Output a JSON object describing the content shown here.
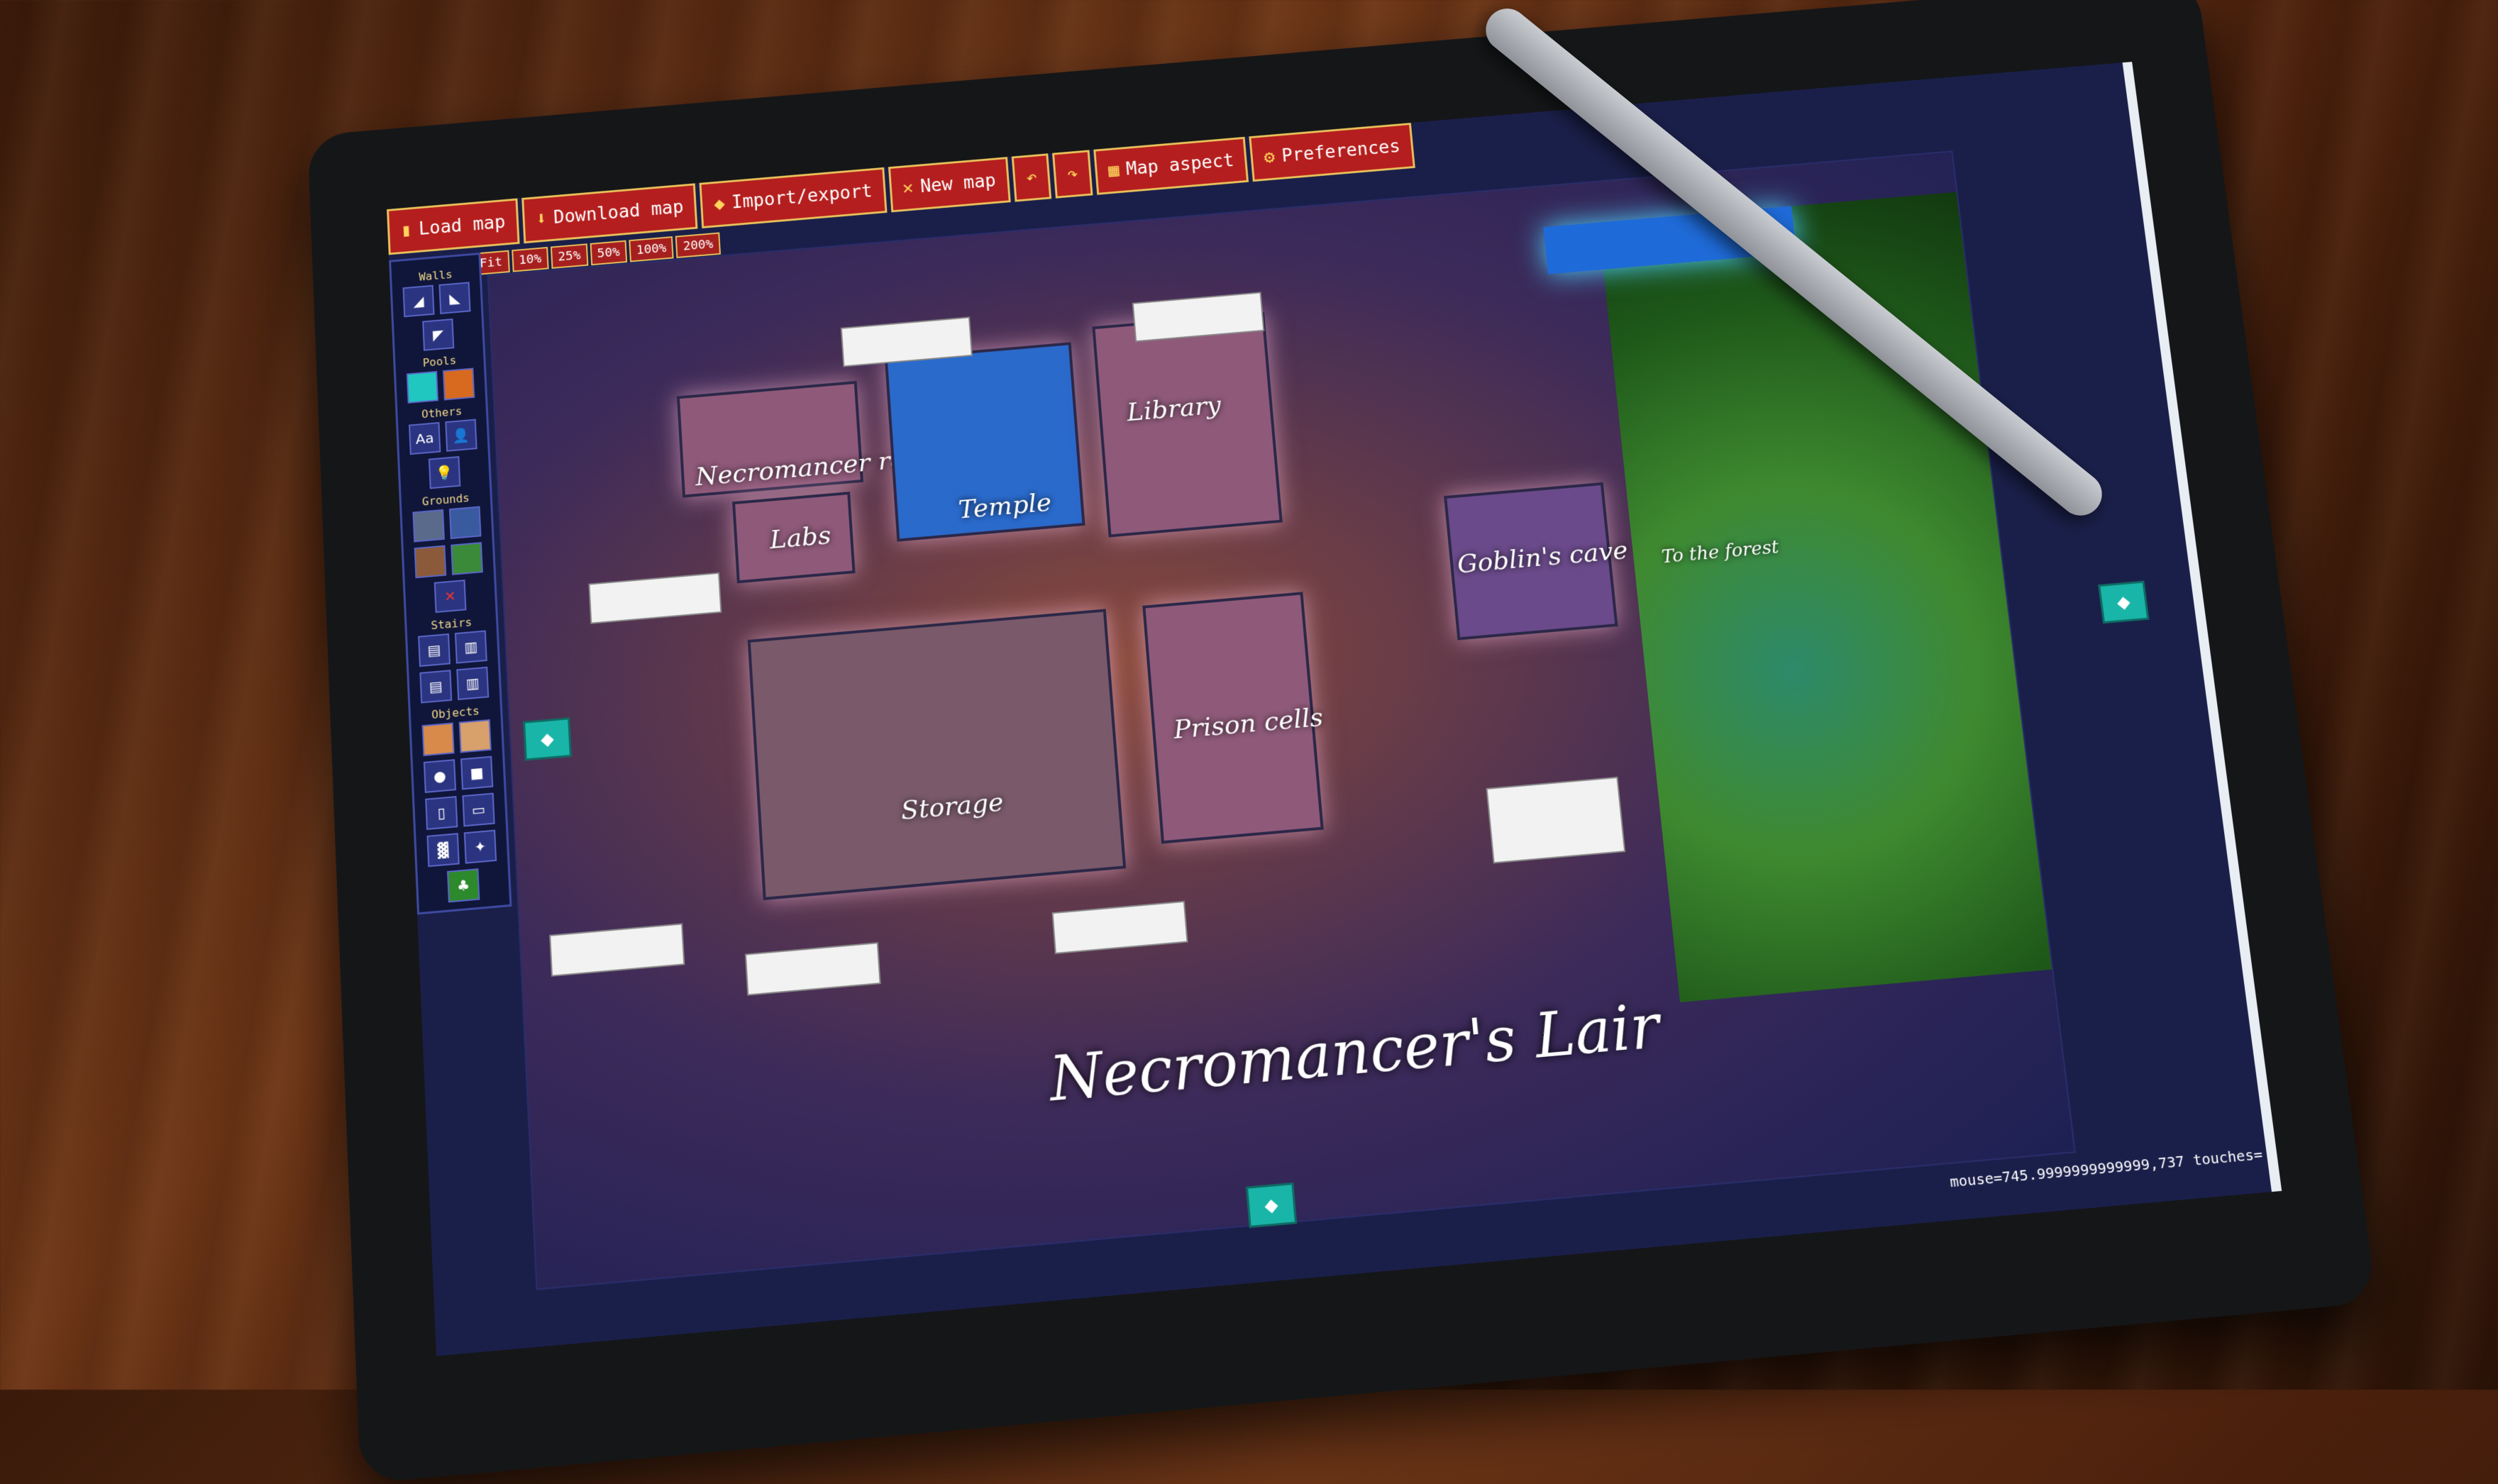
{
  "toolbar": {
    "load_map": "Load map",
    "download_map": "Download map",
    "import_export": "Import/export",
    "new_map": "New map",
    "map_aspect": "Map aspect",
    "preferences": "Preferences"
  },
  "zoom": {
    "fit": "Fit",
    "z10": "10%",
    "z25": "25%",
    "z50": "50%",
    "z100": "100%",
    "z200": "200%"
  },
  "palette": {
    "walls": "Walls",
    "pools": "Pools",
    "others": "Others",
    "grounds": "Grounds",
    "stairs": "Stairs",
    "objects": "Objects"
  },
  "rooms": {
    "necromancer_room": "Necromancer room",
    "temple": "Temple",
    "library": "Library",
    "labs": "Labs",
    "storage": "Storage",
    "prison_cells": "Prison cells",
    "goblins_cave": "Goblin's cave",
    "to_the_forest": "To the forest"
  },
  "map_title": "Necromancer's Lair",
  "status": "mouse=745.9999999999999,737 touches="
}
